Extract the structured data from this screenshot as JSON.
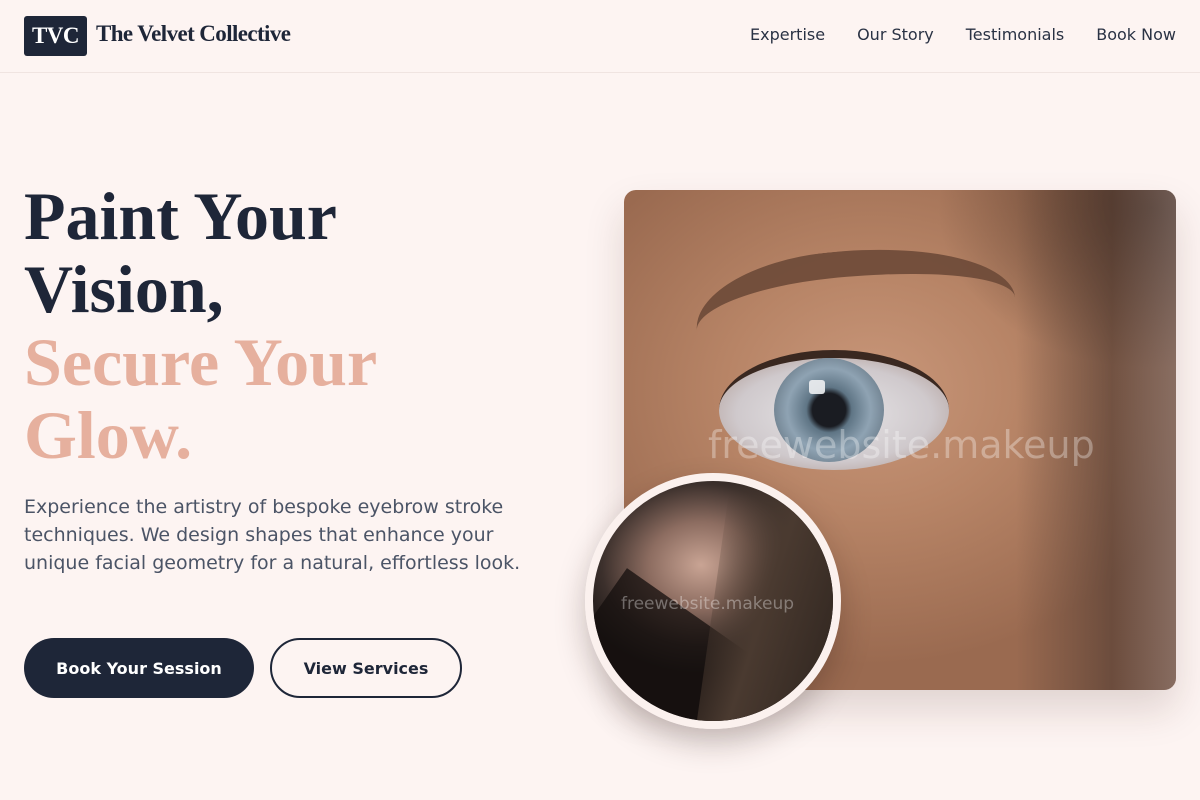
{
  "header": {
    "logo_text": "TVC",
    "brand_name": "The Velvet Collective",
    "nav": [
      {
        "label": "Expertise"
      },
      {
        "label": "Our Story"
      },
      {
        "label": "Testimonials"
      },
      {
        "label": "Book Now"
      }
    ]
  },
  "hero": {
    "title_lines": [
      "Paint Your",
      "Vision,",
      "Secure Your",
      "Glow."
    ],
    "description": "Experience the artistry of bespoke eyebrow stroke techniques. We design shapes that enhance your unique facial geometry for a natural, effortless look.",
    "primary_button": "Book Your Session",
    "secondary_button": "View Services",
    "main_image_watermark": "freewebsite.makeup",
    "circle_image_watermark": "freewebsite.makeup"
  },
  "colors": {
    "navy": "#1e2638",
    "accent": "#e6b09e",
    "background": "#fdf4f2",
    "body_text": "#4b5466"
  }
}
